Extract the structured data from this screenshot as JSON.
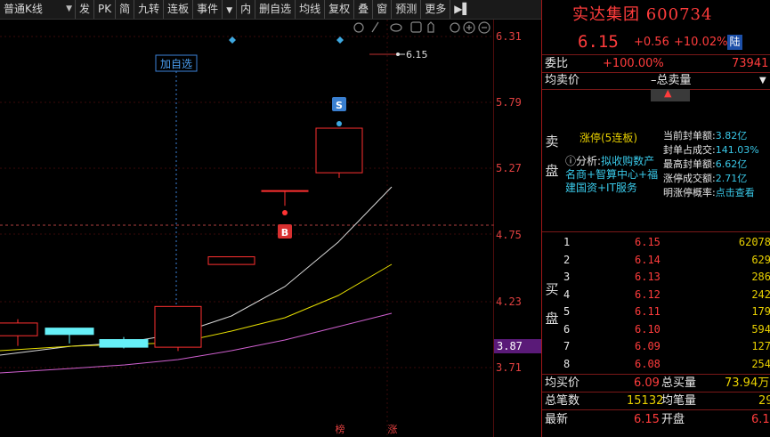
{
  "toolbar": {
    "kline_type": "普通K线",
    "buttons": [
      "发",
      "PK",
      "简",
      "九转",
      "连板",
      "事件",
      "内",
      "删自选",
      "均线",
      "复权",
      "叠",
      "窗",
      "预测",
      "更多"
    ]
  },
  "chart": {
    "add_watch_label": "加自选",
    "price_flag": "6.15",
    "marker_s": "S",
    "marker_b": "B",
    "bottom_tags": [
      "榜",
      "涨"
    ],
    "y_ticks": [
      "6.31",
      "5.79",
      "5.27",
      "4.75",
      "4.23",
      "3.71"
    ],
    "y_current": "3.87",
    "candles": [
      {
        "open": 3.96,
        "close": 4.06,
        "high": 4.09,
        "low": 3.88,
        "color": "red"
      },
      {
        "open": 3.97,
        "close": 4.02,
        "high": 4.02,
        "low": 3.9,
        "color": "cyan"
      },
      {
        "open": 3.87,
        "close": 3.93,
        "high": 3.95,
        "low": 3.86,
        "color": "cyan"
      },
      {
        "open": 3.87,
        "close": 4.19,
        "high": 4.19,
        "low": 3.84,
        "color": "red"
      },
      {
        "open": 4.52,
        "close": 4.58,
        "high": 4.58,
        "low": 4.52,
        "color": "red"
      },
      {
        "open": 5.1,
        "close": 5.1,
        "high": 5.1,
        "low": 4.98,
        "color": "red"
      },
      {
        "open": 5.24,
        "close": 5.59,
        "high": 5.59,
        "low": 5.2,
        "color": "red"
      }
    ]
  },
  "quote": {
    "name_code": "实达集团 600734",
    "price": "6.15",
    "change": "+0.56",
    "pct": "+10.02%",
    "market_tag": "陆",
    "weibi_label": "委比",
    "weibi_val": "+100.00%",
    "weicha_val": "73941",
    "jun_mai_label": "均卖价",
    "zong_mai_label": "–总卖量",
    "sell_side_label": [
      "卖",
      "盘"
    ],
    "buy_side_label": [
      "买",
      "盘"
    ],
    "limit_up": "涨停(5连板)",
    "analysis_prefix": "分析:",
    "analysis_text": "拟收购数产名商+智算中心+福建国资+IT服务",
    "stats": [
      {
        "label": "当前封单额:",
        "value": "3.82亿"
      },
      {
        "label": "封单占成交:",
        "value": "141.03%"
      },
      {
        "label": "最高封单额:",
        "value": "6.62亿"
      },
      {
        "label": "涨停成交额:",
        "value": "2.71亿"
      },
      {
        "label": "明涨停概率:",
        "value": "点击查看"
      }
    ],
    "bids": [
      {
        "lvl": "1",
        "price": "6.15",
        "vol": "62078"
      },
      {
        "lvl": "2",
        "price": "6.14",
        "vol": "629"
      },
      {
        "lvl": "3",
        "price": "6.13",
        "vol": "286"
      },
      {
        "lvl": "4",
        "price": "6.12",
        "vol": "242"
      },
      {
        "lvl": "5",
        "price": "6.11",
        "vol": "179"
      },
      {
        "lvl": "6",
        "price": "6.10",
        "vol": "594"
      },
      {
        "lvl": "7",
        "price": "6.09",
        "vol": "127"
      },
      {
        "lvl": "8",
        "price": "6.08",
        "vol": "254"
      }
    ],
    "jun_buy_label": "均买价",
    "jun_buy_val": "6.09",
    "zong_buy_label": "总买量",
    "zong_buy_val": "73.94万",
    "zong_bi_label": "总笔数",
    "zong_bi_val": "15132",
    "jun_bi_label": "均笔量",
    "jun_bi_val": "29",
    "zuixin_label": "最新",
    "zuixin_val": "6.15",
    "kaipan_label": "开盘",
    "kaipan_val": "6.1"
  }
}
